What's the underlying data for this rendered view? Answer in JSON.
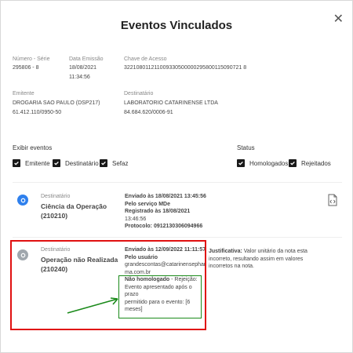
{
  "title": "Eventos Vinculados",
  "info": {
    "numero_label": "Número - Série",
    "numero_value": "295806 - 8",
    "data_label": "Data Emissão",
    "data_value1": "18/08/2021",
    "data_value2": "11:34:56",
    "chave_label": "Chave de Acesso",
    "chave_value": "322108011211009330500000295800115090721 8",
    "emitente_label": "Emitente",
    "emitente_name": "DROGARIA SAO PAULO (DSP217)",
    "emitente_cnpj": "61.412.110/0950-50",
    "destinatario_label": "Destinatário",
    "destinatario_name": "LABORATORIO CATARINENSE LTDA",
    "destinatario_cnpj": "84.684.620/0006-91"
  },
  "exibir": {
    "label": "Exibir eventos",
    "options": [
      {
        "label": "Emitente",
        "checked": true
      },
      {
        "label": "Destinatário",
        "checked": true
      },
      {
        "label": "Sefaz",
        "checked": true
      }
    ]
  },
  "status": {
    "label": "Status",
    "options": [
      {
        "label": "Homologados",
        "checked": true
      },
      {
        "label": "Rejeitados",
        "checked": true
      }
    ]
  },
  "events": [
    {
      "type": "Destinatário",
      "name1": "Ciência da Operação",
      "name2": "(210210)",
      "icon_color": "#2f80ed",
      "details": {
        "enviado": "Enviado às 18/08/2021 13:45:56",
        "pelo": "Pelo serviço MDe",
        "registrado": "Registrado às 18/08/2021",
        "registrado_time": "13:46:56",
        "protocolo": "Protocolo: 0912130306094966"
      }
    },
    {
      "type": "Destinatário",
      "name1": "Operação não Realizada",
      "name2": "(210240)",
      "icon_color": "#a0a7ad",
      "details": {
        "enviado": "Enviado às 12/09/2022 11:11:57",
        "pelo": "Pelo usuário",
        "email1": "grandescontas@catarinensephar",
        "email2": "ma.com.br",
        "nao_label": "Não homologado",
        "nao_text1": " - Rejeição:",
        "nao_text2": "Evento apresentado após o prazo",
        "nao_text3": "permitido para o evento: [6",
        "nao_text4": "meses]"
      },
      "justificativa_label": "Justificativa:",
      "justificativa_text1": " Valor unitário da nota esta",
      "justificativa_text2": "incorreto, resultando assim em valores",
      "justificativa_text3": "incorretos na nota."
    }
  ],
  "colors": {
    "annotation_red": "#e01010",
    "annotation_green": "#1a8a1a",
    "accent_blue": "#2f80ed"
  }
}
